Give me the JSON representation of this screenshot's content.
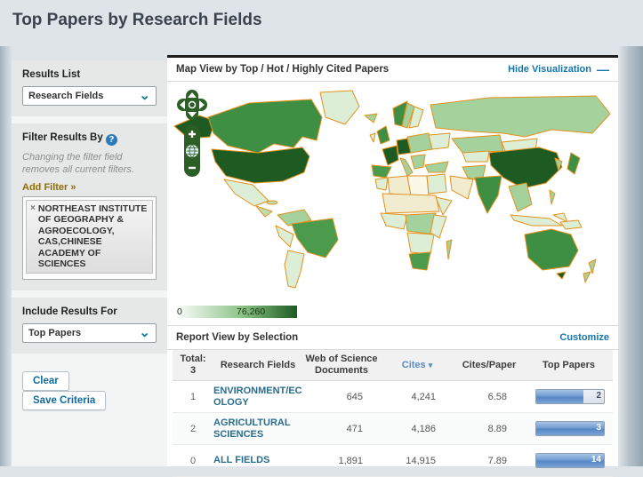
{
  "page": {
    "title": "Top Papers by Research Fields"
  },
  "icons": {
    "dropdown_chevron": "⌄",
    "help": "?",
    "remove": "×",
    "collapse_dash": "—",
    "sort_desc": "▾"
  },
  "sidebar": {
    "results_list": {
      "label": "Results List",
      "selected": "Research Fields"
    },
    "filter": {
      "label": "Filter Results By",
      "note": "Changing the filter field removes all current filters.",
      "add_filter": "Add Filter »",
      "items": [
        {
          "text": "NORTHEAST INSTITUTE OF GEOGRAPHY & AGROECOLOGY, CAS,CHINESE ACADEMY OF SCIENCES"
        }
      ]
    },
    "include": {
      "label": "Include Results For",
      "selected": "Top Papers"
    },
    "buttons": {
      "clear": "Clear",
      "save": "Save Criteria"
    }
  },
  "map": {
    "title": "Map View by  Top / Hot / Highly Cited Papers",
    "hide_label": "Hide Visualization",
    "legend": {
      "min": "0",
      "max": "76,260"
    },
    "colors": {
      "country_border": "#e2921e",
      "scale_low": "#ffffff",
      "scale_high": "#1d5b21"
    }
  },
  "report": {
    "title": "Report View by Selection",
    "customize": "Customize",
    "header": {
      "total_line1": "Total:",
      "total_line2": "3",
      "field": "Research Fields",
      "docs": "Web of Science Documents",
      "cites": "Cites",
      "cites_per_paper": "Cites/Paper",
      "top_papers": "Top Papers"
    },
    "rows": [
      {
        "rank": "1",
        "field": "ENVIRONMENT/ECOLOGY",
        "docs": "645",
        "cites": "4,241",
        "cpp": "6.58",
        "top": "2",
        "bar_pct": 70
      },
      {
        "rank": "2",
        "field": "AGRICULTURAL SCIENCES",
        "docs": "471",
        "cites": "4,186",
        "cpp": "8.89",
        "top": "3",
        "bar_pct": 100
      },
      {
        "rank": "0",
        "field": "ALL FIELDS",
        "docs": "1,891",
        "cites": "14,915",
        "cpp": "7.89",
        "top": "14",
        "bar_pct": 100
      }
    ]
  }
}
